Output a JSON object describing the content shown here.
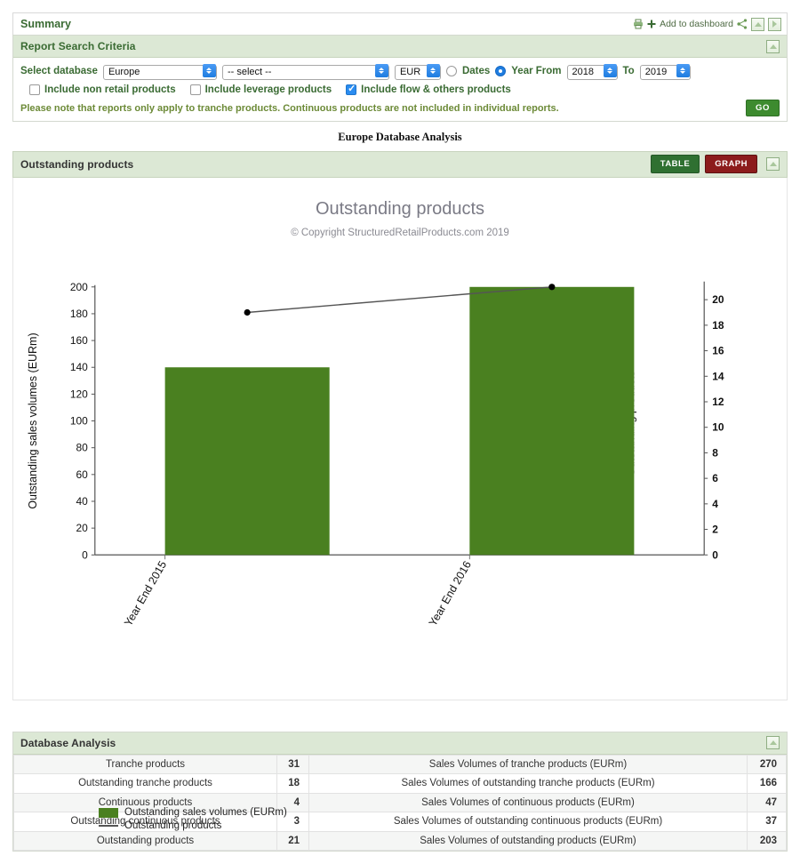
{
  "summary": {
    "title": "Summary",
    "add_to_dashboard": "Add to dashboard",
    "icons": {
      "print": "printer-icon",
      "plus": "plus-icon",
      "share": "share-icon"
    }
  },
  "search_criteria": {
    "title": "Report Search Criteria",
    "select_database_label": "Select database",
    "database_value": "Europe",
    "category_value": "-- select --",
    "currency_value": "EUR",
    "dates_label": "Dates",
    "dates_selected": false,
    "year_from_label": "Year From",
    "year_from_selected": true,
    "year_from_value": "2018",
    "to_label": "To",
    "year_to_value": "2019",
    "checkboxes": [
      {
        "label": "Include non retail products",
        "checked": false
      },
      {
        "label": "Include leverage products",
        "checked": false
      },
      {
        "label": "Include flow & others products",
        "checked": true
      }
    ],
    "note": "Please note that reports only apply to tranche products. Continuous products are not included in individual reports.",
    "go_label": "GO"
  },
  "db_analysis_heading": "Europe Database Analysis",
  "outstanding_panel": {
    "title": "Outstanding products",
    "table_button": "TABLE",
    "graph_button": "GRAPH"
  },
  "chart_data": {
    "type": "bar",
    "title": "Outstanding products",
    "subtitle": "© Copyright StructuredRetailProducts.com 2019",
    "categories": [
      "Year End 2015",
      "Year End 2016"
    ],
    "xlabel": "",
    "ylabel": "Outstanding sales volumes (EURm)",
    "y2label": "Outstanding products",
    "ylim": [
      0,
      200
    ],
    "y2lim": [
      0,
      21
    ],
    "yticks": [
      0,
      20,
      40,
      60,
      80,
      100,
      120,
      140,
      160,
      180,
      200
    ],
    "y2ticks": [
      0,
      2,
      4,
      6,
      8,
      10,
      12,
      14,
      16,
      18,
      20
    ],
    "grid": false,
    "legend_position": "bottom-left",
    "bar_color": "#4a8020",
    "line_color": "#555555",
    "series": [
      {
        "name": "Outstanding sales volumes (EURm)",
        "type": "bar",
        "axis": "left",
        "values": [
          140,
          200
        ]
      },
      {
        "name": "Outstanding products",
        "type": "line",
        "axis": "right",
        "values": [
          19,
          21
        ]
      }
    ]
  },
  "database_analysis": {
    "title": "Database Analysis",
    "rows": [
      {
        "name": "Tranche products",
        "count": "31",
        "volume_name": "Sales Volumes of tranche products (EURm)",
        "volume": "270"
      },
      {
        "name": "Outstanding tranche products",
        "count": "18",
        "volume_name": "Sales Volumes of outstanding tranche products (EURm)",
        "volume": "166"
      },
      {
        "name": "Continuous products",
        "count": "4",
        "volume_name": "Sales Volumes of continuous products (EURm)",
        "volume": "47"
      },
      {
        "name": "Outstanding continuous products",
        "count": "3",
        "volume_name": "Sales Volumes of outstanding continuous products (EURm)",
        "volume": "37"
      },
      {
        "name": "Outstanding products",
        "count": "21",
        "volume_name": "Sales Volumes of outstanding products (EURm)",
        "volume": "203"
      }
    ]
  }
}
